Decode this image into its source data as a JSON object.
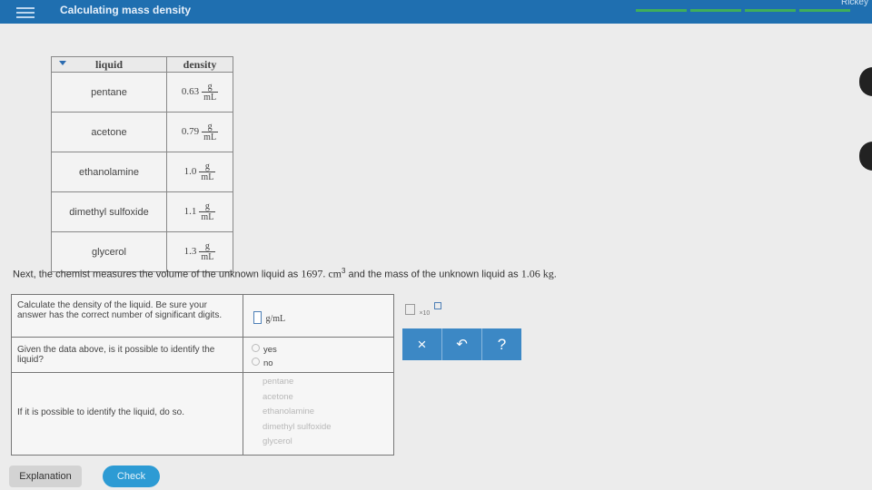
{
  "header": {
    "title": "Calculating mass density",
    "user": "Rickey"
  },
  "table": {
    "headers": {
      "liquid": "liquid",
      "density": "density"
    },
    "rows": [
      {
        "name": "pentane",
        "value": "0.63",
        "num": "g",
        "den": "mL"
      },
      {
        "name": "acetone",
        "value": "0.79",
        "num": "g",
        "den": "mL"
      },
      {
        "name": "ethanolamine",
        "value": "1.0",
        "num": "g",
        "den": "mL"
      },
      {
        "name": "dimethyl sulfoxide",
        "value": "1.1",
        "num": "g",
        "den": "mL"
      },
      {
        "name": "glycerol",
        "value": "1.3",
        "num": "g",
        "den": "mL"
      }
    ]
  },
  "sentence": {
    "part1": "Next, the chemist measures the volume of the unknown liquid as",
    "volume": "1697. cm",
    "exponent": "3",
    "part2": "and the mass of the unknown liquid as",
    "mass": "1.06 kg",
    "end": "."
  },
  "questions": {
    "q1": {
      "text": "Calculate the density of the liquid. Be sure your answer has the correct number of significant digits.",
      "unit": "g/mL"
    },
    "q2": {
      "text": "Given the data above, is it possible to identify the liquid?",
      "options": [
        "yes",
        "no"
      ]
    },
    "q3": {
      "text": "If it is possible to identify the liquid, do so.",
      "options": [
        "pentane",
        "acetone",
        "ethanolamine",
        "dimethyl sulfoxide",
        "glycerol"
      ]
    }
  },
  "tools": {
    "x10": "×10",
    "clear": "×",
    "undo": "↶",
    "help": "?"
  },
  "buttons": {
    "explanation": "Explanation",
    "check": "Check"
  }
}
